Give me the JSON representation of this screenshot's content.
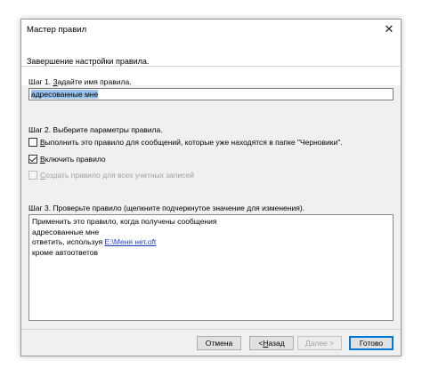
{
  "window": {
    "title": "Мастер правил"
  },
  "header": {
    "subtitle": "Завершение настройки правила."
  },
  "step1": {
    "label_prefix": "Шаг 1. ",
    "label_accel": "З",
    "label_rest": "адайте имя правила.",
    "value": "адресованные мне"
  },
  "step2": {
    "label": "Шаг 2. Выберите параметры правила.",
    "options": [
      {
        "accel": "В",
        "rest": "ыполнить это правило для сообщений, которые уже находятся в папке \"Черновики\".",
        "checked": false,
        "disabled": false
      },
      {
        "accel": "В",
        "rest": "ключить правило",
        "checked": true,
        "disabled": false
      },
      {
        "accel": "С",
        "rest": "оздать правило для всех учетных записей",
        "checked": false,
        "disabled": true
      }
    ]
  },
  "step3": {
    "label": "Шаг 3. Проверьте правило (щелкните подчеркнутое значение для изменения).",
    "lines": {
      "line1": "Применить это правило, когда получены сообщения",
      "line2": "адресованные мне",
      "line3_prefix": "ответить, используя ",
      "line3_link": "E:\\Меня нет.oft",
      "line4": "кроме автоответов"
    }
  },
  "buttons": {
    "cancel": "Отмена",
    "back_prefix": "< ",
    "back_accel": "Н",
    "back_rest": "азад",
    "next": "Далее >",
    "finish": "Готово"
  }
}
